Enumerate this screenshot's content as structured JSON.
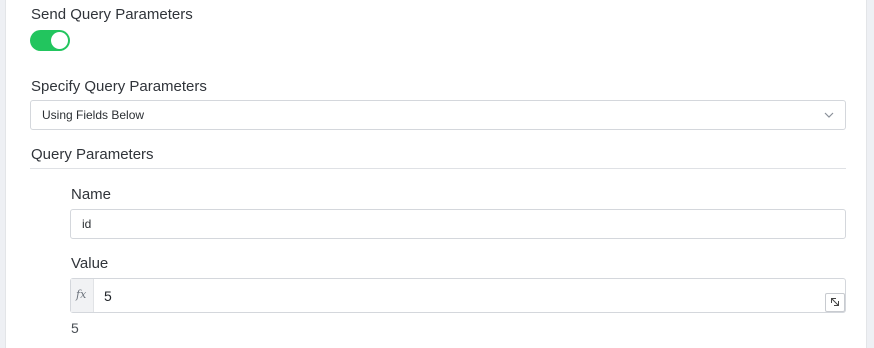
{
  "send_query": {
    "label": "Send Query Parameters",
    "enabled": true,
    "accent_color": "#22c55e"
  },
  "specify": {
    "label": "Specify Query Parameters",
    "selected": "Using Fields Below"
  },
  "query_params": {
    "title": "Query Parameters",
    "name_label": "Name",
    "name_value": "id",
    "value_label": "Value",
    "fx_icon": "fx",
    "value": "5",
    "preview": "5"
  },
  "icons": {
    "select_chevron": "chevron-down-icon",
    "expand_editor": "expand-icon",
    "expression": "fx-icon"
  }
}
